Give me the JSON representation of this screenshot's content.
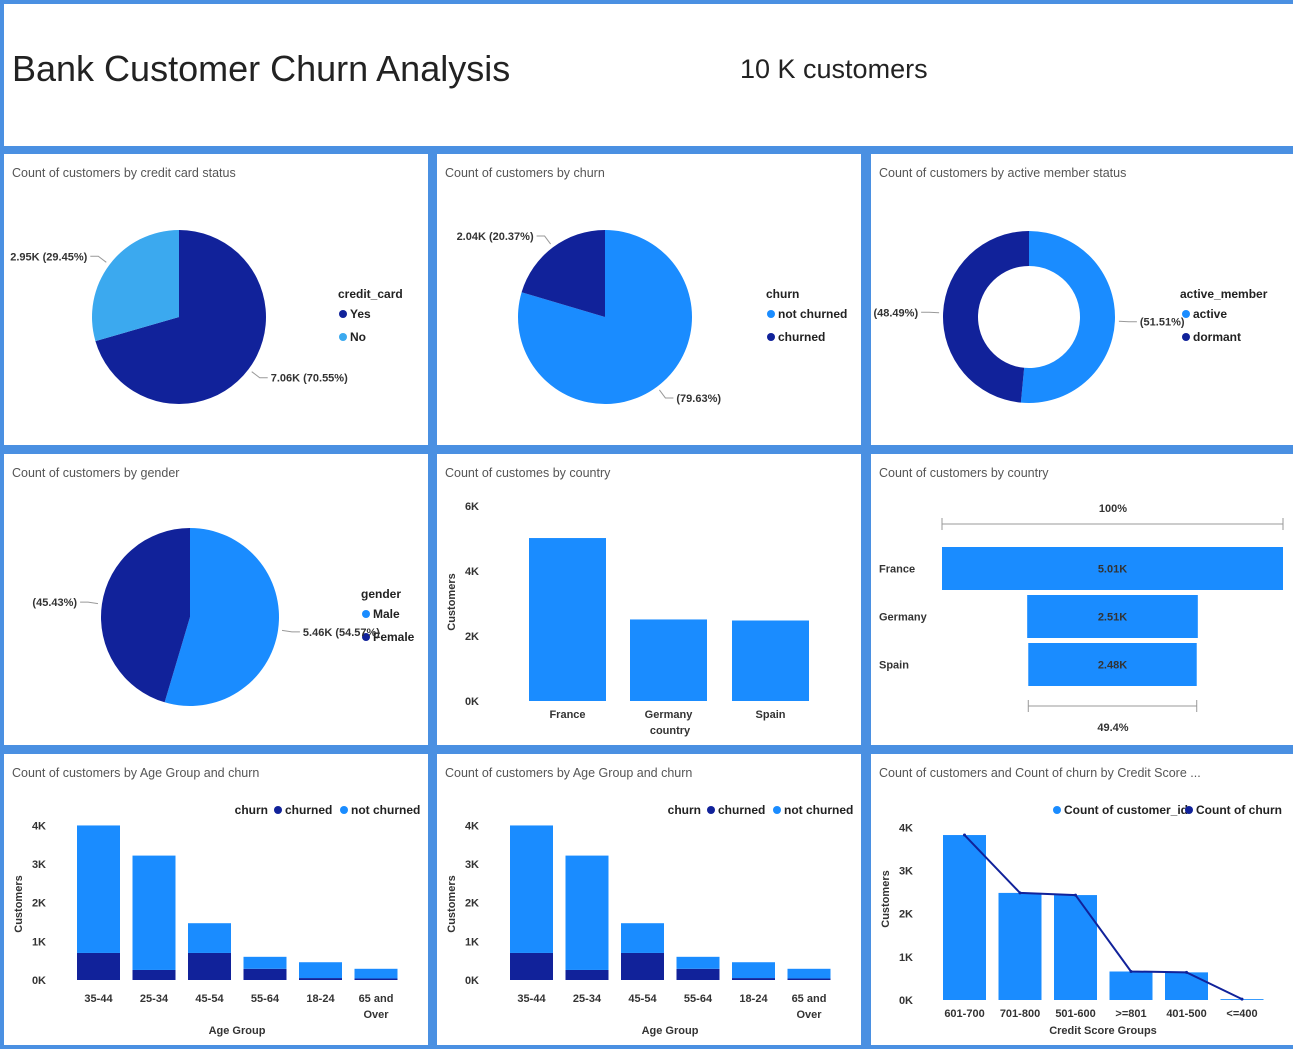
{
  "header": {
    "title": "Bank Customer Churn Analysis",
    "customers": "10 K customers"
  },
  "colors": {
    "dark": "#11229a",
    "blue": "#1a8cff",
    "light": "#3ba9ef",
    "line": "#11229a"
  },
  "panels": {
    "credit": {
      "title": "Count of customers by credit card status",
      "legend_title": "credit_card",
      "chart_data": {
        "type": "pie",
        "labels": [
          "Yes",
          "No"
        ],
        "values": [
          7.06,
          2.95
        ],
        "data_labels": [
          "7.06K (70.55%)",
          "2.95K (29.45%)"
        ]
      }
    },
    "churn": {
      "title": "Count of customers by churn",
      "legend_title": "churn",
      "chart_data": {
        "type": "pie",
        "labels": [
          "not churned",
          "churned"
        ],
        "values": [
          7.96,
          2.04
        ],
        "data_labels": [
          "(79.63%)",
          "2.04K (20.37%)"
        ]
      }
    },
    "active": {
      "title": "Count of customers by active member status",
      "legend_title": "active_member",
      "chart_data": {
        "type": "pie",
        "donut": true,
        "labels": [
          "active",
          "dormant"
        ],
        "values": [
          51.51,
          48.49
        ],
        "data_labels": [
          "(51.51%)",
          "(48.49%)"
        ]
      }
    },
    "gender": {
      "title": "Count of customers by gender",
      "legend_title": "gender",
      "chart_data": {
        "type": "pie",
        "labels": [
          "Male",
          "Female"
        ],
        "values": [
          5.46,
          4.54
        ],
        "data_labels": [
          "5.46K (54.57%)",
          "(45.43%)"
        ]
      }
    },
    "country_bar": {
      "title": "Count of customes by country",
      "chart_data": {
        "type": "bar",
        "categories": [
          "France",
          "Germany",
          "Spain"
        ],
        "values": [
          5014,
          2509,
          2477
        ],
        "xlabel": "country",
        "ylabel": "Customers",
        "ylim": [
          0,
          6000
        ],
        "yticks": [
          "0K",
          "2K",
          "4K",
          "6K"
        ]
      }
    },
    "country_funnel": {
      "title": "Count of customers by country",
      "top_label": "100%",
      "bottom_label": "49.4%",
      "chart_data": {
        "type": "bar",
        "categories": [
          "France",
          "Germany",
          "Spain"
        ],
        "values": [
          5014,
          2509,
          2477
        ],
        "data_labels": [
          "5.01K",
          "2.51K",
          "2.48K"
        ]
      }
    },
    "age1": {
      "title": "Count of customers by Age Group and churn",
      "legend_title": "churn",
      "chart_data": {
        "type": "bar",
        "stacked": true,
        "categories": [
          "35-44",
          "25-34",
          "45-54",
          "55-64",
          "18-24",
          "65 and Over"
        ],
        "series": [
          {
            "name": "churned",
            "values": [
              700,
              260,
              700,
              290,
              50,
              40
            ]
          },
          {
            "name": "not churned",
            "values": [
              3300,
              2960,
              770,
              310,
              410,
              250
            ]
          }
        ],
        "xlabel": "Age Group",
        "ylabel": "Customers",
        "ylim": [
          0,
          4400
        ],
        "yticks": [
          "0K",
          "1K",
          "2K",
          "3K",
          "4K"
        ]
      }
    },
    "age2": {
      "title": "Count of customers by Age Group and churn",
      "legend_title": "churn",
      "chart_data": {
        "type": "bar",
        "stacked": true,
        "categories": [
          "35-44",
          "25-34",
          "45-54",
          "55-64",
          "18-24",
          "65 and Over"
        ],
        "series": [
          {
            "name": "churned",
            "values": [
              700,
              260,
              700,
              290,
              50,
              40
            ]
          },
          {
            "name": "not churned",
            "values": [
              3300,
              2960,
              770,
              310,
              410,
              250
            ]
          }
        ],
        "xlabel": "Age Group",
        "ylabel": "Customers",
        "ylim": [
          0,
          4400
        ],
        "yticks": [
          "0K",
          "1K",
          "2K",
          "3K",
          "4K"
        ]
      }
    },
    "credit_score": {
      "title": "Count of customers and Count of churn by Credit Score ...",
      "chart_data": {
        "type": "bar",
        "categories": [
          "601-700",
          "701-800",
          "501-600",
          ">=801",
          "401-500",
          "<=400"
        ],
        "series": [
          {
            "name": "Count of customer_id",
            "values": [
              3820,
              2480,
              2430,
              660,
              640,
              20
            ]
          },
          {
            "name": "Count of churn",
            "values": [
              3820,
              2480,
              2430,
              660,
              640,
              20
            ]
          }
        ],
        "xlabel": "Credit Score Groups",
        "ylabel": "Customers",
        "ylim": [
          0,
          4400
        ],
        "yticks": [
          "0K",
          "1K",
          "2K",
          "3K",
          "4K"
        ]
      }
    }
  }
}
